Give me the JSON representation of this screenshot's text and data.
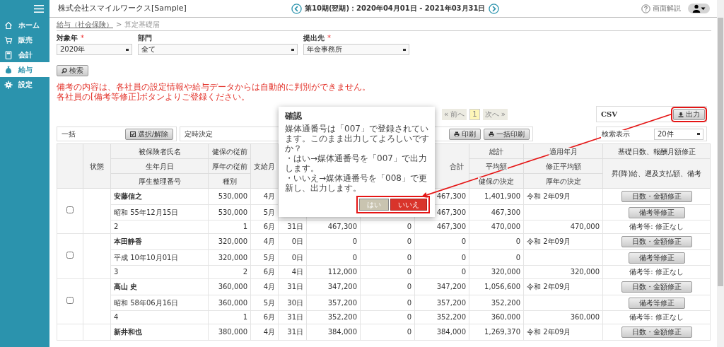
{
  "sidebar": {
    "items": [
      {
        "label": "ホーム",
        "selected": false
      },
      {
        "label": "販売",
        "selected": false
      },
      {
        "label": "会計",
        "selected": false
      },
      {
        "label": "給与",
        "selected": true
      },
      {
        "label": "設定",
        "selected": false
      }
    ]
  },
  "header": {
    "title": "株式会社スマイルワークス[Sample]",
    "period": "第10期(翌期)：2020年04月01日 - 2021年03月31日",
    "help": "画面解説"
  },
  "breadcrumb": {
    "items": [
      {
        "label": "給与（社会保険）",
        "link": true
      },
      {
        "label": "算定基礎届",
        "link": false
      }
    ],
    "separator": ">"
  },
  "required_mark": "*",
  "filters": [
    {
      "label": "対象年",
      "required": true,
      "value": "2020年"
    },
    {
      "label": "部門",
      "required": false,
      "value": "全て"
    },
    {
      "label": "提出先",
      "required": true,
      "value": "年金事務所"
    }
  ],
  "search_button": "検索",
  "notice": [
    "備考の内容は、各社員の設定情報や給与データからは自動的に判別ができません。",
    "各社員の[備考等修正]ボタンよりご登録ください。"
  ],
  "pagination": {
    "prev": "« 前へ",
    "pages": [
      {
        "label": "1",
        "selected": true
      }
    ],
    "next": "次へ »"
  },
  "export": {
    "format": "CSV",
    "button": "出力",
    "highlighted": true
  },
  "toolbar": {
    "bulk_label": "一括",
    "select_button": "選択/解除",
    "type_label": "定時決定",
    "print_button": "印刷",
    "bulk_print_button": "一括印刷",
    "page_size_label": "検索表示",
    "page_size": "20件"
  },
  "table": {
    "columns": [
      null,
      {
        "headers": [
          "状態"
        ]
      },
      {
        "headers": [
          "被保険者氏名",
          "生年月日",
          "厚生整理番号"
        ]
      },
      {
        "headers": [
          "健保の従前",
          "厚年の従前",
          "種別"
        ]
      },
      {
        "headers": [
          "支給月"
        ]
      },
      null,
      null,
      null,
      {
        "headers": [
          "合計"
        ]
      },
      {
        "headers": [
          "総計",
          "平均額",
          "健保の決定"
        ]
      },
      {
        "headers": [
          "適用年月",
          "修正平均額",
          "厚年の決定"
        ]
      },
      {
        "headers": [
          "基礎日数、報酬月額修正",
          "昇(降)給、遡及支払額、備考"
        ]
      }
    ],
    "employees": [
      {
        "checked": false,
        "rows": [
          {
            "cells": [
              "安藤信之",
              "530,000",
              "4月",
              null,
              null,
              null,
              "467,300",
              "1,401,900",
              "令和 2年09月"
            ],
            "action": {
              "kind": "button",
              "label": "日数・金額修正"
            }
          },
          {
            "cells": [
              "昭和 55年12月15日",
              "530,000",
              "5月",
              null,
              null,
              null,
              "467,300",
              "467,300",
              null
            ],
            "action": {
              "kind": "button",
              "label": "備考等修正"
            }
          },
          {
            "cells": [
              "2",
              "1",
              "6月",
              "31日",
              "467,300",
              "0",
              "467,300",
              "470,000",
              "470,000"
            ],
            "action": {
              "kind": "text",
              "label": "備考等: 修正なし"
            }
          }
        ]
      },
      {
        "checked": false,
        "rows": [
          {
            "cells": [
              "本田静香",
              "320,000",
              "4月",
              "0日",
              "0",
              "0",
              "0",
              "0",
              "令和 2年09月"
            ],
            "action": {
              "kind": "button",
              "label": "日数・金額修正"
            }
          },
          {
            "cells": [
              "平成 10年10月01日",
              "320,000",
              "5月",
              "0日",
              "0",
              "0",
              "0",
              "0",
              null
            ],
            "action": {
              "kind": "button",
              "label": "備考等修正"
            }
          },
          {
            "cells": [
              "3",
              "2",
              "6月",
              "4日",
              "112,000",
              "0",
              "0",
              "320,000",
              "320,000"
            ],
            "action": {
              "kind": "text",
              "label": "備考等: 修正なし"
            }
          }
        ]
      },
      {
        "checked": false,
        "rows": [
          {
            "cells": [
              "高山 史",
              "360,000",
              "4月",
              "31日",
              "347,200",
              "0",
              "347,200",
              "1,056,600",
              "令和 2年09月"
            ],
            "action": {
              "kind": "button",
              "label": "日数・金額修正"
            }
          },
          {
            "cells": [
              "昭和 58年06月16日",
              "360,000",
              "5月",
              "30日",
              "357,200",
              "0",
              "357,200",
              "352,200",
              null
            ],
            "action": {
              "kind": "button",
              "label": "備考等修正"
            }
          },
          {
            "cells": [
              "4",
              "1",
              "6月",
              "31日",
              "352,200",
              "0",
              "352,200",
              "360,000",
              "360,000"
            ],
            "action": {
              "kind": "text",
              "label": "備考等: 修正なし"
            }
          }
        ]
      },
      {
        "rows": [
          {
            "cells": [
              "新井和也",
              "380,000",
              "4月",
              "31日",
              "384,000",
              "0",
              "384,000",
              "1,269,370",
              "令和 2年09月"
            ],
            "action": {
              "kind": "button",
              "label": "日数・金額修正"
            }
          }
        ]
      }
    ]
  },
  "dialog": {
    "title": "確認",
    "message": [
      "媒体通番号は「007」で登録されています。このまま出力してよろしいですか？",
      "・はい→媒体通番号を「007」で出力します。",
      "・いいえ→媒体通番号を「008」で更新し、出力します。"
    ],
    "buttons": [
      {
        "label": "はい",
        "kind": "secondary"
      },
      {
        "label": "いいえ",
        "kind": "danger"
      }
    ],
    "highlighted": true
  },
  "annotation_arrow": true
}
